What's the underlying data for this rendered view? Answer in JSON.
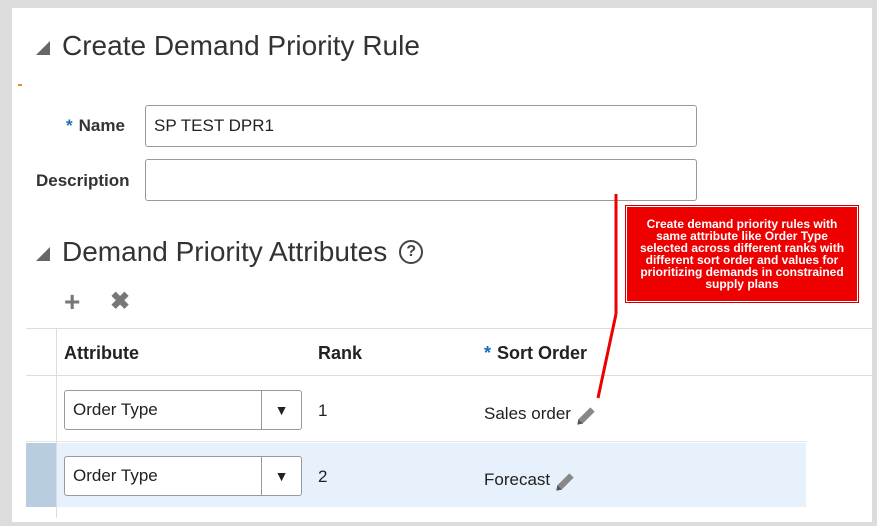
{
  "form": {
    "title": "Create Demand Priority Rule",
    "name_label": "Name",
    "name_value": "SP TEST DPR1",
    "description_label": "Description",
    "description_value": ""
  },
  "attributes_section": {
    "title": "Demand Priority Attributes",
    "help": "?",
    "add_icon": "+",
    "delete_icon": "✖"
  },
  "table": {
    "columns": {
      "attribute": "Attribute",
      "rank": "Rank",
      "sort_order": "Sort Order"
    },
    "rows": [
      {
        "attribute": "Order Type",
        "rank": "1",
        "sort_order": "Sales order",
        "selected": false
      },
      {
        "attribute": "Order Type",
        "rank": "2",
        "sort_order": "Forecast",
        "selected": true
      }
    ]
  },
  "annotation": {
    "text": "Create demand priority rules with same attribute like Order Type selected across different ranks with different sort order and values for prioritizing demands in constrained supply plans"
  },
  "colors": {
    "accent_required": "#1a6bc2",
    "callout": "#ee0000",
    "selected_row": "#e7f1fb"
  }
}
